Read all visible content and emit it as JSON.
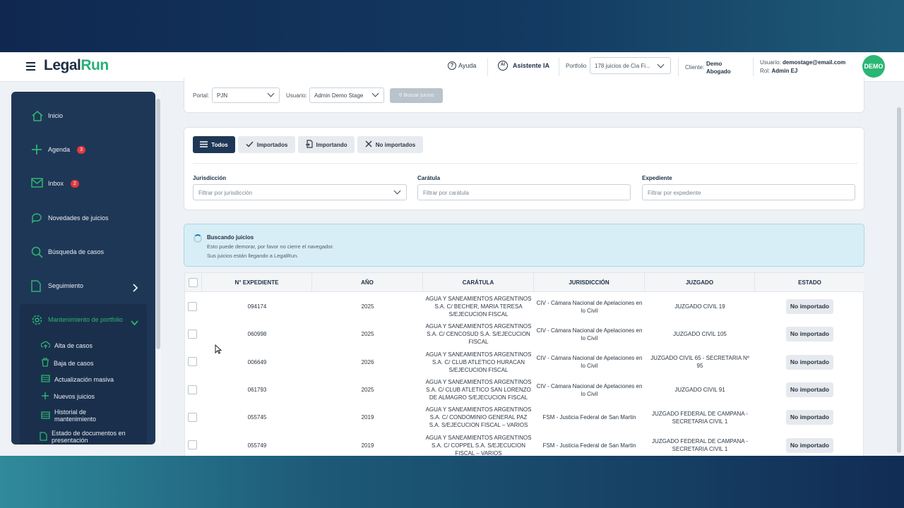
{
  "header": {
    "logo_part1": "Legal",
    "logo_part2": "Run",
    "help_label": "Ayuda",
    "ai_label": "Asistente IA",
    "ai_icon_text": "AI",
    "portfolio_label": "Portfolio",
    "portfolio_value": "178 juicios de Cia Fi...",
    "client_label": "Cliente:",
    "client_value": "Demo Abogado",
    "user_label": "Usuario:",
    "user_value": "demostage@email.com",
    "role_label": "Rol:",
    "role_value": "Admin EJ",
    "avatar_text": "DEMO"
  },
  "sidebar": {
    "items": [
      {
        "label": "Inicio",
        "icon": "home-icon"
      },
      {
        "label": "Agenda",
        "icon": "plus-icon",
        "badge": "3"
      },
      {
        "label": "Inbox",
        "icon": "mail-icon",
        "badge": "2"
      },
      {
        "label": "Novedades de juicios",
        "icon": "chat-icon"
      },
      {
        "label": "Búsqueda de casos",
        "icon": "search-icon"
      },
      {
        "label": "Seguimiento",
        "icon": "document-icon"
      },
      {
        "label": "Mantenimiento de portfolio",
        "icon": "gear-icon"
      }
    ],
    "subitems": [
      {
        "label": "Alta de casos",
        "icon": "cloud-upload-icon"
      },
      {
        "label": "Baja de casos",
        "icon": "trash-icon"
      },
      {
        "label": "Actualización masiva",
        "icon": "table-icon"
      },
      {
        "label": "Nuevos juicios",
        "icon": "plus-icon"
      },
      {
        "label": "Historial de mantenimiento",
        "icon": "table-icon"
      },
      {
        "label": "Estado de documentos en presentación",
        "icon": "file-icon"
      }
    ]
  },
  "filters_top": {
    "portal_label": "Portal:",
    "portal_value": "PJN",
    "usuario_label": "Usuario:",
    "usuario_value": "Admin Demo Stage",
    "search_button": "Buscar juicios"
  },
  "tabs": [
    {
      "label": "Todos",
      "active": true
    },
    {
      "label": "Importados",
      "active": false
    },
    {
      "label": "Importando",
      "active": false
    },
    {
      "label": "No importados",
      "active": false
    }
  ],
  "filters": {
    "jurisdiccion_label": "Jurisdicción",
    "jurisdiccion_placeholder": "Filtrar por jurisdicción",
    "caratula_label": "Carátula",
    "caratula_placeholder": "Filtrar por carátula",
    "expediente_label": "Expediente",
    "expediente_placeholder": "Filtrar por expediente"
  },
  "alert": {
    "title": "Buscando juicios",
    "line1": "Esto puede demorar, por favor no cierre el navegador.",
    "line2": "Sus juicios están llegando a LegalRun."
  },
  "table": {
    "columns": [
      "N° EXPEDIENTE",
      "AÑO",
      "CARÁTULA",
      "JURISDICCIÓN",
      "JUZGADO",
      "ESTADO"
    ],
    "rows": [
      {
        "expediente": "094174",
        "anio": "2025",
        "caratula": "AGUA Y SANEAMIENTOS ARGENTINOS S.A. C/ BECHER, MARIA TERESA S/EJECUCION FISCAL",
        "jurisdiccion": "CIV - Cámara Nacional de Apelaciones en lo Civil",
        "juzgado": "JUZGADO CIVIL 19",
        "estado": "No importado"
      },
      {
        "expediente": "060998",
        "anio": "2025",
        "caratula": "AGUA Y SANEAMIENTOS ARGENTINOS S.A. C/ CENCOSUD S.A. S/EJECUCION FISCAL",
        "jurisdiccion": "CIV - Cámara Nacional de Apelaciones en lo Civil",
        "juzgado": "JUZGADO CIVIL 105",
        "estado": "No importado"
      },
      {
        "expediente": "006649",
        "anio": "2026",
        "caratula": "AGUA Y SANEAMIENTOS ARGENTINOS S.A. C/ CLUB ATLETICO HURACAN S/EJECUCION FISCAL",
        "jurisdiccion": "CIV - Cámara Nacional de Apelaciones en lo Civil",
        "juzgado": "JUZGADO CIVIL 65 - SECRETARIA Nº 95",
        "estado": "No importado"
      },
      {
        "expediente": "061793",
        "anio": "2025",
        "caratula": "AGUA Y SANEAMIENTOS ARGENTINOS S.A. C/ CLUB ATLETICO SAN LORENZO DE ALMAGRO S/EJECUCION FISCAL",
        "jurisdiccion": "CIV - Cámara Nacional de Apelaciones en lo Civil",
        "juzgado": "JUZGADO CIVIL 91",
        "estado": "No importado"
      },
      {
        "expediente": "055745",
        "anio": "2019",
        "caratula": "AGUA Y SANEAMIENTOS ARGENTINOS S.A. C/ CONDOMINIO GENERAL PAZ S.A. S/EJECUCION FISCAL – VARIOS",
        "jurisdiccion": "FSM - Justicia Federal de San Martin",
        "juzgado": "JUZGADO FEDERAL DE CAMPANA - SECRETARIA CIVIL 1",
        "estado": "No importado"
      },
      {
        "expediente": "055749",
        "anio": "2019",
        "caratula": "AGUA Y SANEAMIENTOS ARGENTINOS S.A. C/ COPPEL S.A. S/EJECUCION FISCAL – VARIOS",
        "jurisdiccion": "FSM - Justicia Federal de San Martin",
        "juzgado": "JUZGADO FEDERAL DE CAMPANA - SECRETARIA CIVIL 1",
        "estado": "No importado"
      }
    ]
  },
  "colors": {
    "sidebar_bg": "#1f3756",
    "brand_green": "#27b07a",
    "badge_red": "#e0393e",
    "alert_bg": "#d8eef6"
  }
}
